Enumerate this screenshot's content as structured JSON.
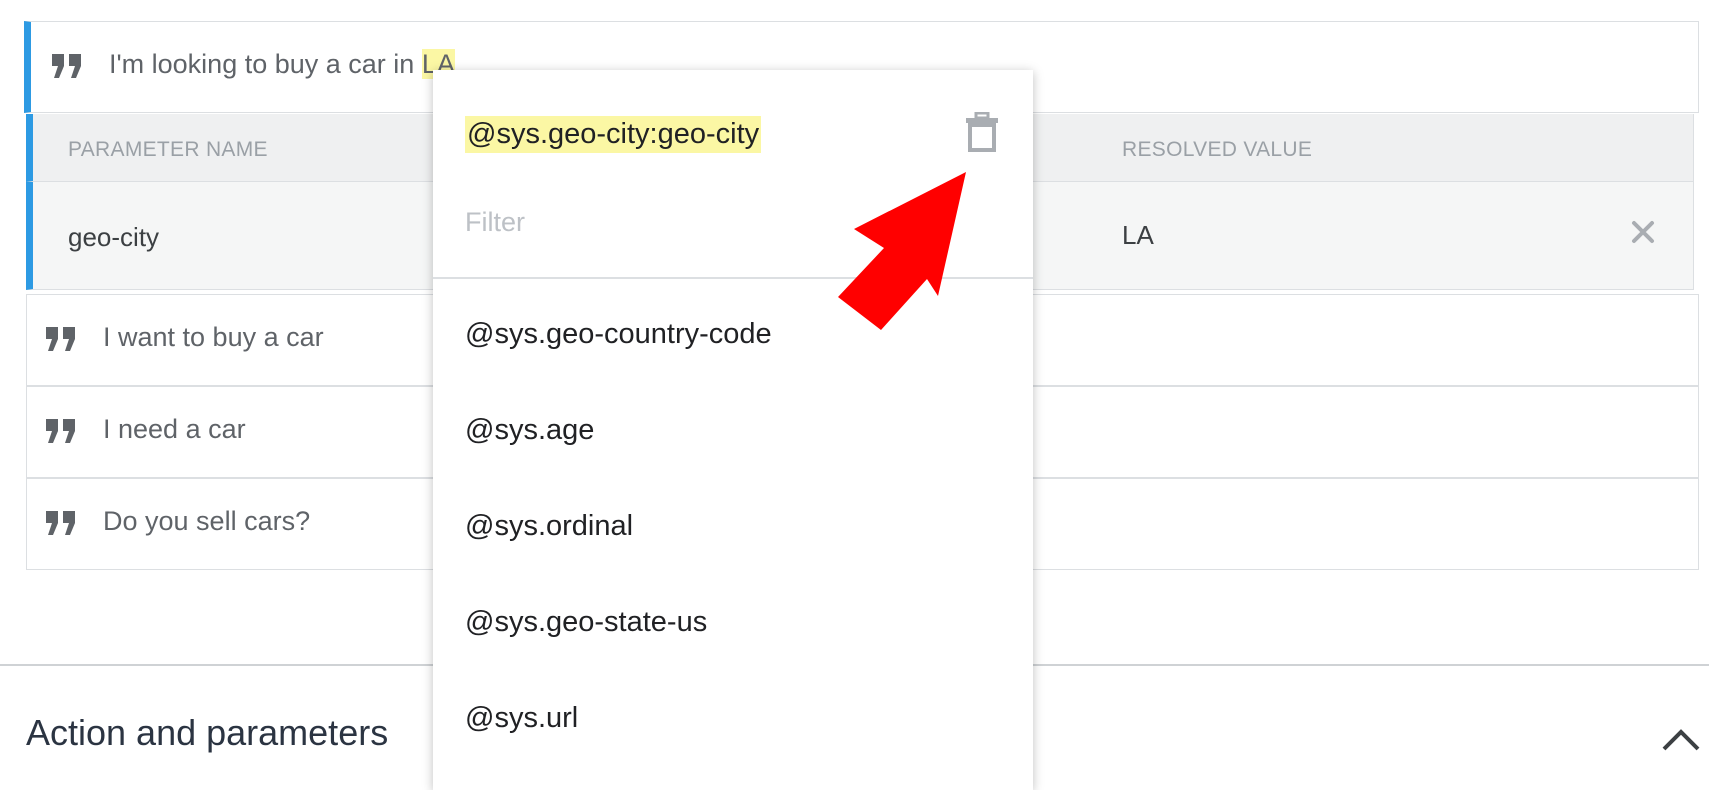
{
  "phrases": [
    {
      "pre": "I'm looking to buy a car in ",
      "hl": "LA",
      "post": ""
    },
    {
      "text": "I want to buy a car"
    },
    {
      "text": "I need a car"
    },
    {
      "text": "Do you sell cars?"
    }
  ],
  "param_table": {
    "col_name": "PARAMETER NAME",
    "col_value": "RESOLVED VALUE",
    "row": {
      "name": "geo-city",
      "value": "LA"
    }
  },
  "dropdown": {
    "selected": "@sys.geo-city:geo-city",
    "filter_placeholder": "Filter",
    "items": [
      "@sys.geo-country-code",
      "@sys.age",
      "@sys.ordinal",
      "@sys.geo-state-us",
      "@sys.url"
    ]
  },
  "section": {
    "title": "Action and parameters"
  },
  "icons": {
    "quote": "quote-icon",
    "close": "close-icon",
    "trash": "trash-icon",
    "chevron": "chevron-up-icon",
    "arrow": "red-pointer-arrow"
  },
  "colors": {
    "accent": "#2d9ae3",
    "highlight": "#fbf7a4",
    "arrow": "#ff0000"
  }
}
